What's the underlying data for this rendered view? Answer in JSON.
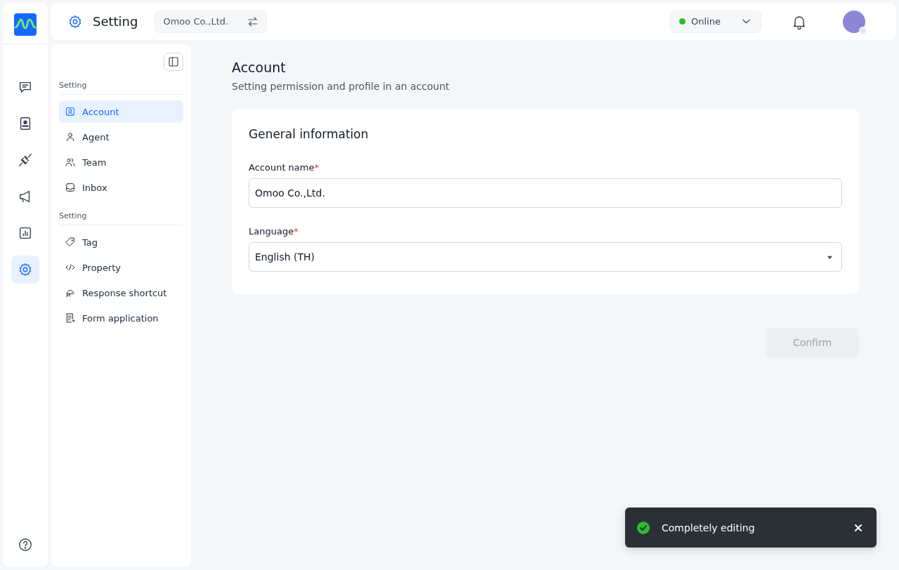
{
  "rail": {
    "items": [
      {
        "kind": "chat",
        "selected": false
      },
      {
        "kind": "contacts",
        "selected": false
      },
      {
        "kind": "plug",
        "selected": false
      },
      {
        "kind": "megaphone",
        "selected": false
      },
      {
        "kind": "chart",
        "selected": false
      },
      {
        "kind": "settings",
        "selected": true
      }
    ],
    "footer": {
      "kind": "help"
    }
  },
  "header": {
    "title": "Setting",
    "workspace": "Omoo Co.,Ltd.",
    "status": {
      "label": "Online",
      "online": true
    }
  },
  "sidebar": {
    "sections": [
      {
        "heading": "Setting",
        "items": [
          {
            "label": "Account",
            "kind": "account",
            "selected": true
          },
          {
            "label": "Agent",
            "kind": "agent",
            "selected": false
          },
          {
            "label": "Team",
            "kind": "team",
            "selected": false
          },
          {
            "label": "Inbox",
            "kind": "inbox",
            "selected": false
          }
        ]
      },
      {
        "heading": "Setting",
        "items": [
          {
            "label": "Tag",
            "kind": "tag",
            "selected": false
          },
          {
            "label": "Property",
            "kind": "code",
            "selected": false
          },
          {
            "label": "Response shortcut",
            "kind": "shortcut",
            "selected": false
          },
          {
            "label": "Form application",
            "kind": "form",
            "selected": false
          }
        ]
      }
    ]
  },
  "page": {
    "title": "Account",
    "subtitle": "Setting permission and profile in an account",
    "card": {
      "title": "General information",
      "fields": [
        {
          "kind": "text",
          "label": "Account name",
          "required_mark": "*",
          "value": "Omoo Co.,Ltd."
        },
        {
          "kind": "select",
          "label": "Language",
          "required_mark": "*",
          "value": "English (TH)"
        }
      ]
    },
    "confirm": {
      "label": "Confirm",
      "disabled": true
    }
  },
  "toast": {
    "message": "Completely editing"
  }
}
